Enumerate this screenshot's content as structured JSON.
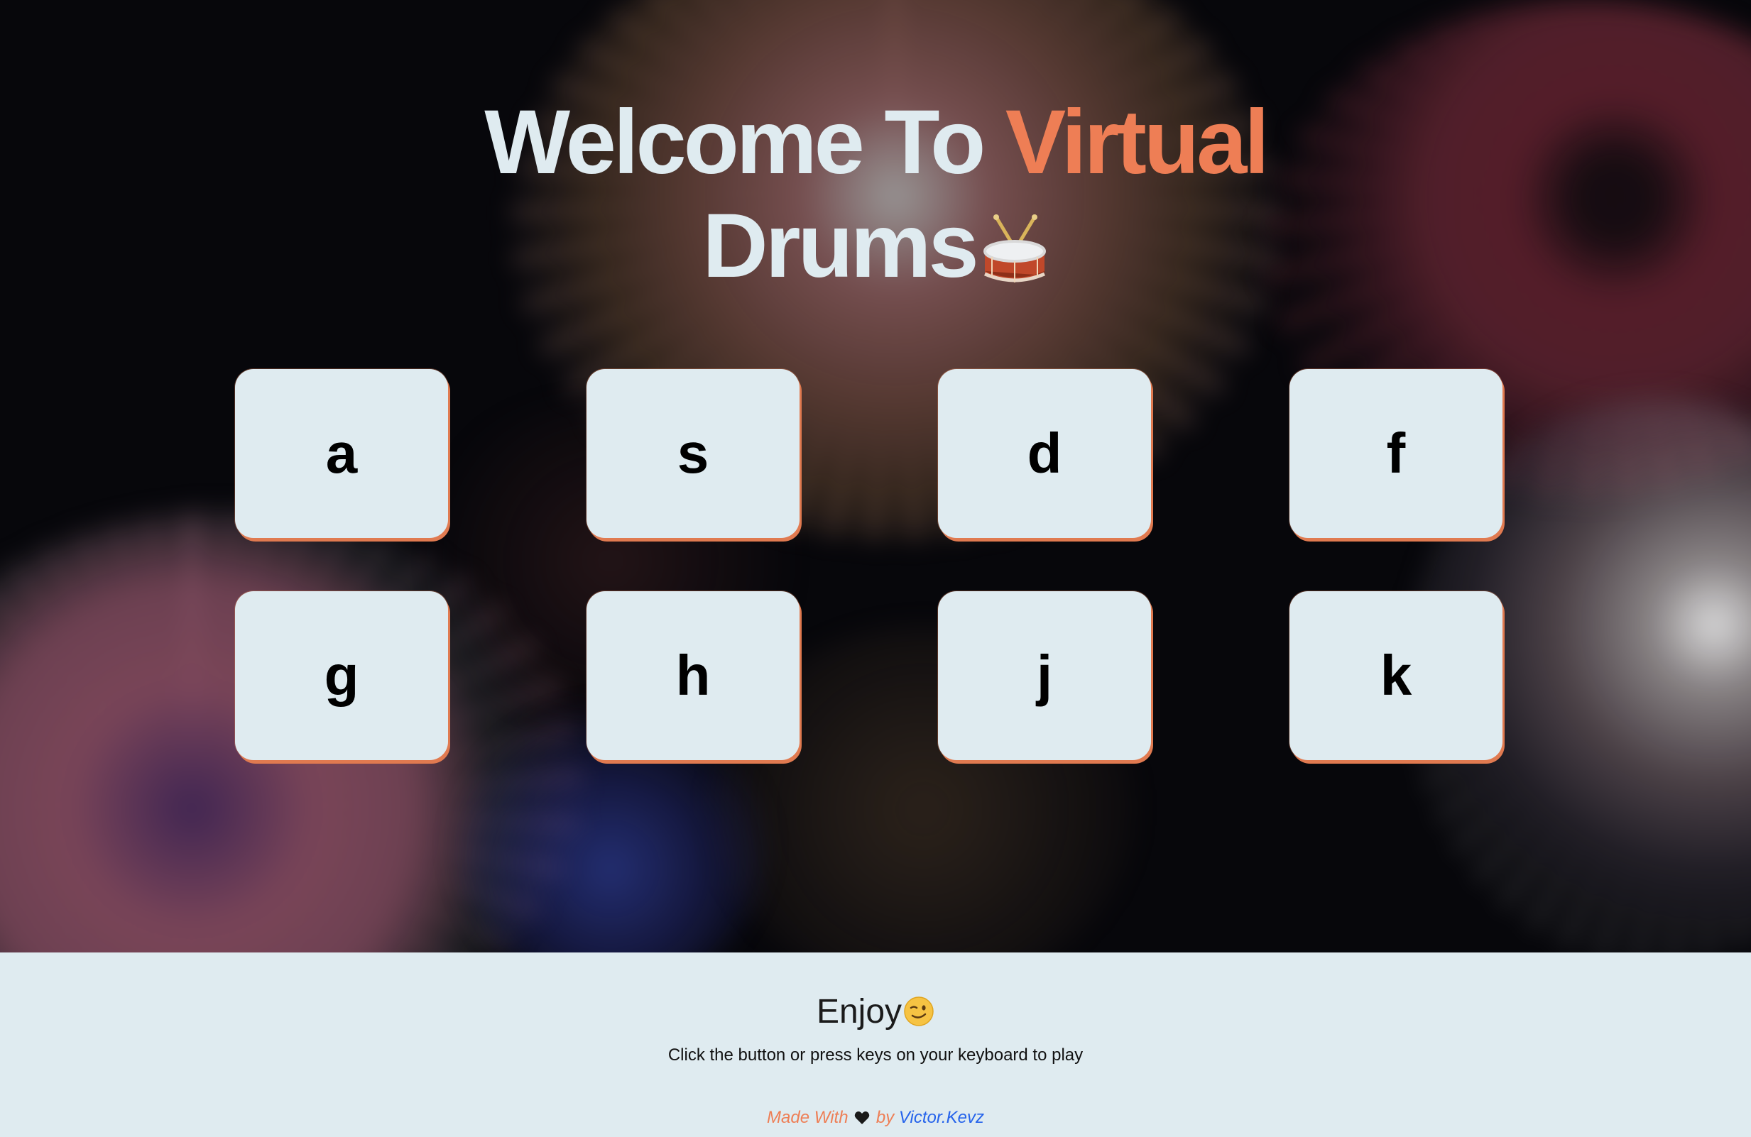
{
  "header": {
    "title_part1": "Welcome To ",
    "title_accent": "Virtual",
    "title_line2": "Drums",
    "title_icon": "drum-icon"
  },
  "drums": {
    "keys": [
      "a",
      "s",
      "d",
      "f",
      "g",
      "h",
      "j",
      "k"
    ]
  },
  "footer": {
    "heading": "Enjoy",
    "heading_icon": "winking-face-icon",
    "subtitle": "Click the button or press keys on your keyboard to play",
    "credit_prefix": "Made With",
    "credit_icon": "black-heart-icon",
    "credit_by": " by ",
    "author_link": "Victor.Kevz"
  },
  "colors": {
    "accent": "#ee7e55",
    "button_bg": "#dfebf0",
    "footer_bg": "#dfebf0",
    "link": "#2563eb"
  }
}
